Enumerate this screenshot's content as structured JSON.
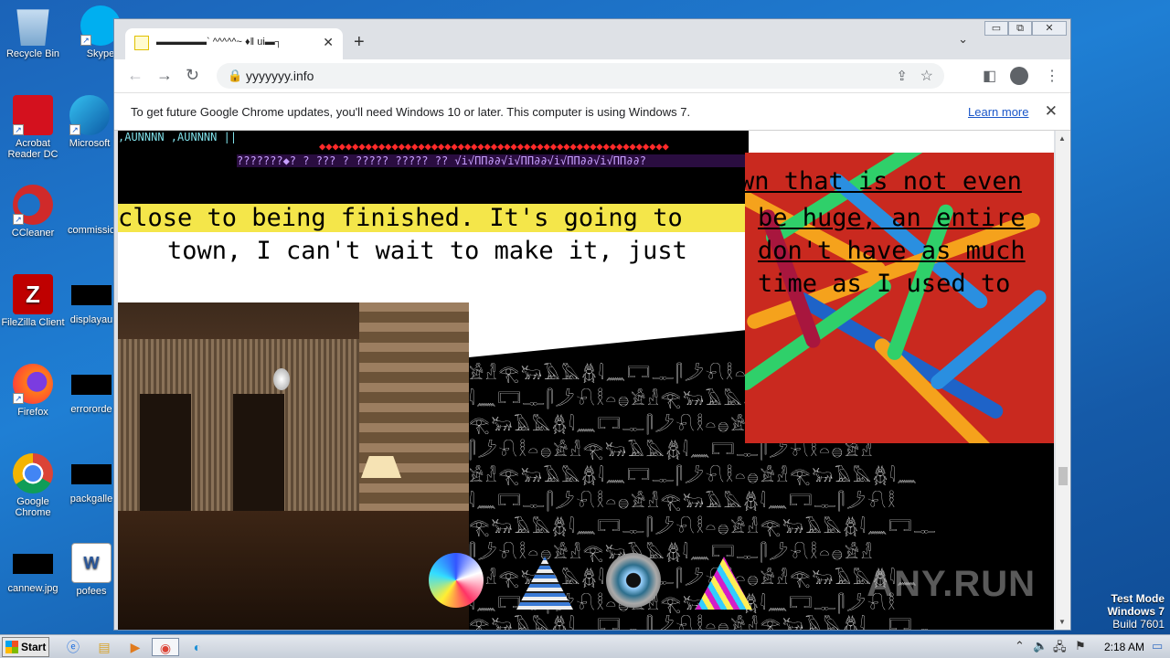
{
  "desktop": {
    "icons": [
      {
        "label": "Recycle Bin"
      },
      {
        "label": "Skype"
      },
      {
        "label": "Acrobat Reader DC"
      },
      {
        "label": "Microsoft"
      },
      {
        "label": "CCleaner"
      },
      {
        "label": "commissio"
      },
      {
        "label": "FileZilla Client"
      },
      {
        "label": "displayau"
      },
      {
        "label": "Firefox"
      },
      {
        "label": "errororde"
      },
      {
        "label": "Google Chrome"
      },
      {
        "label": "packgalle"
      },
      {
        "label": "cannew.jpg"
      },
      {
        "label": "pofees"
      }
    ]
  },
  "browser": {
    "tab": {
      "title": "▬▬▬▬▬` ^^^^^~ ♦‖ ui▬┐"
    },
    "address": {
      "url": "yyyyyyy.info"
    },
    "infobar": {
      "message": "To get future Google Chrome updates, you'll need Windows 10 or later. This computer is using Windows 7.",
      "link": "Learn more"
    }
  },
  "page": {
    "glitch_line1": ",AUNNNN ,AUNNNN ||",
    "glitch_line2": "◆◆◆◆◆◆◆◆◆◆◆◆◆◆◆◆◆◆◆◆◆◆◆◆◆◆◆◆◆◆◆◆◆◆◆◆◆◆◆◆◆◆◆◆◆◆◆◆◆◆◆◆◆",
    "glitch_line3": "???????◆? ? ??? ? ????? ????? ?? √i√ПП∂∂√i√ПП∂∂√i√ПП∂∂√i√ПП∂∂?",
    "text_fragment_right_top": "wn that is not even",
    "text_line_close": "close to being finished. It's going to",
    "text_line_town": "town, I can't wait to make it, just",
    "pipe_lines": [
      "be huge, an entire",
      "don't have as much",
      "time as I used to"
    ],
    "watermark": "ANY.RUN"
  },
  "system": {
    "testmode": [
      "Test Mode",
      "Windows 7",
      "Build 7601"
    ],
    "start_label": "Start",
    "clock": "2:18 AM"
  }
}
